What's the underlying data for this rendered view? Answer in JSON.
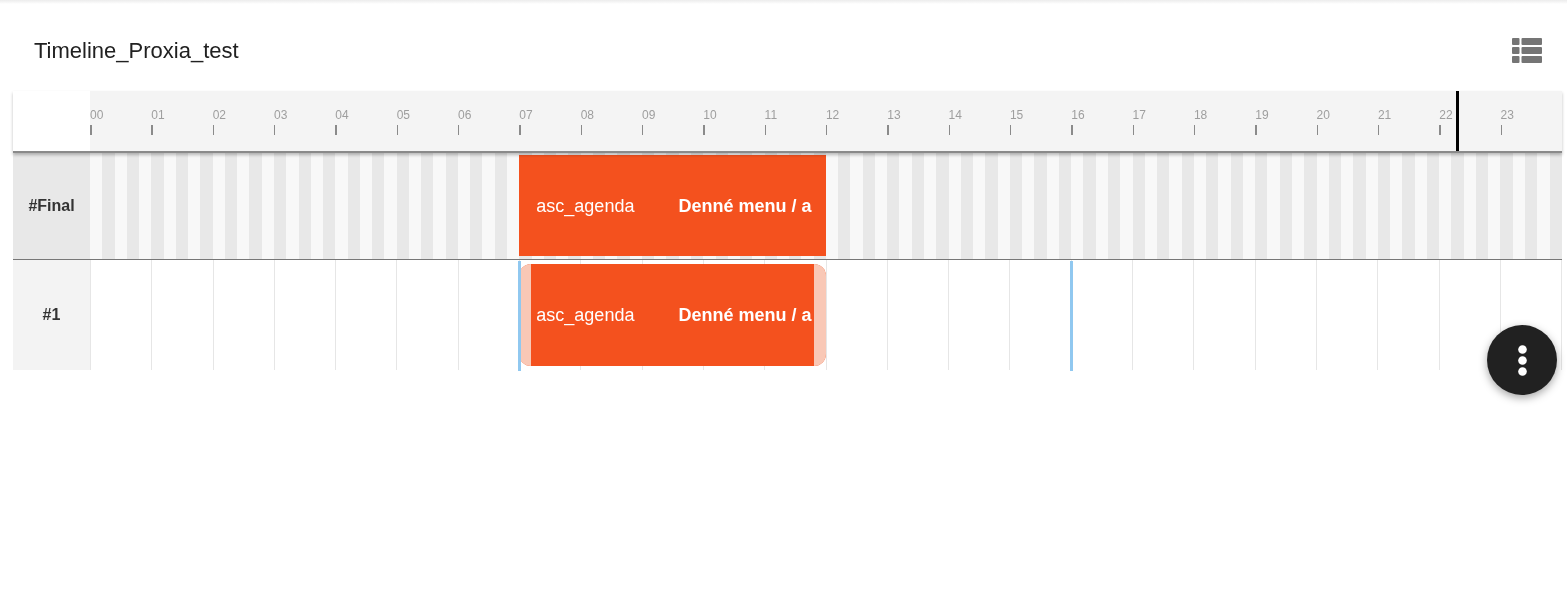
{
  "title": "Timeline_Proxia_test",
  "ruler": {
    "hours": [
      "00",
      "01",
      "02",
      "03",
      "04",
      "05",
      "06",
      "07",
      "08",
      "09",
      "10",
      "11",
      "12",
      "13",
      "14",
      "15",
      "16",
      "17",
      "18",
      "19",
      "20",
      "21",
      "22",
      "23"
    ]
  },
  "rows": [
    {
      "label": "#Final",
      "kind": "striped",
      "snap_guides": false,
      "events": [
        {
          "code": "asc_agenda",
          "title": "Denné menu / a",
          "selected": false
        }
      ]
    },
    {
      "label": "#1",
      "kind": "plain",
      "snap_guides": true,
      "events": [
        {
          "code": "asc_agenda",
          "title": "Denné menu / a",
          "selected": true
        }
      ]
    }
  ]
}
